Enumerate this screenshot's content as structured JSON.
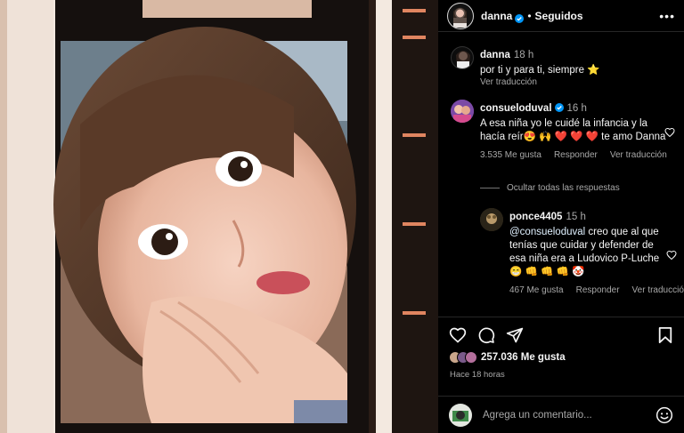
{
  "post": {
    "username": "danna",
    "follow_status": "Seguidos",
    "more_label": "•••"
  },
  "caption": {
    "username": "danna",
    "time": "18 h",
    "text": "por ti y para ti, siempre ⭐",
    "translate": "Ver traducción"
  },
  "comments": [
    {
      "username": "consueloduval",
      "time": "16 h",
      "text": "A esa niña yo le cuidé la infancia y la hacía reír😍 🙌 ❤️ ❤️ ❤️ te amo Danna",
      "likes": "3.535 Me gusta",
      "reply": "Responder",
      "translate": "Ver traducción"
    }
  ],
  "hide_replies": "Ocultar todas las respuestas",
  "reply": {
    "username": "ponce4405",
    "time": "15 h",
    "mention": "@consueloduval",
    "text": " creo que al que tenías que cuidar y defender de esa niña era a Ludovico P-Luche😁 👊 👊 👊 🤡",
    "likes": "467 Me gusta",
    "reply": "Responder",
    "translate": "Ver traducción"
  },
  "likes": {
    "text": "257.036 Me gusta"
  },
  "time_ago": "Hace 18 horas",
  "add_comment": {
    "placeholder": "Agrega un comentario..."
  },
  "icons": [
    "verified-icon",
    "more-icon",
    "heart-icon",
    "comment-icon",
    "share-icon",
    "save-icon",
    "emoji-icon"
  ],
  "colors": {
    "verified": "#0095f6",
    "background": "#000000",
    "secondary_text": "#a8a8a8"
  }
}
